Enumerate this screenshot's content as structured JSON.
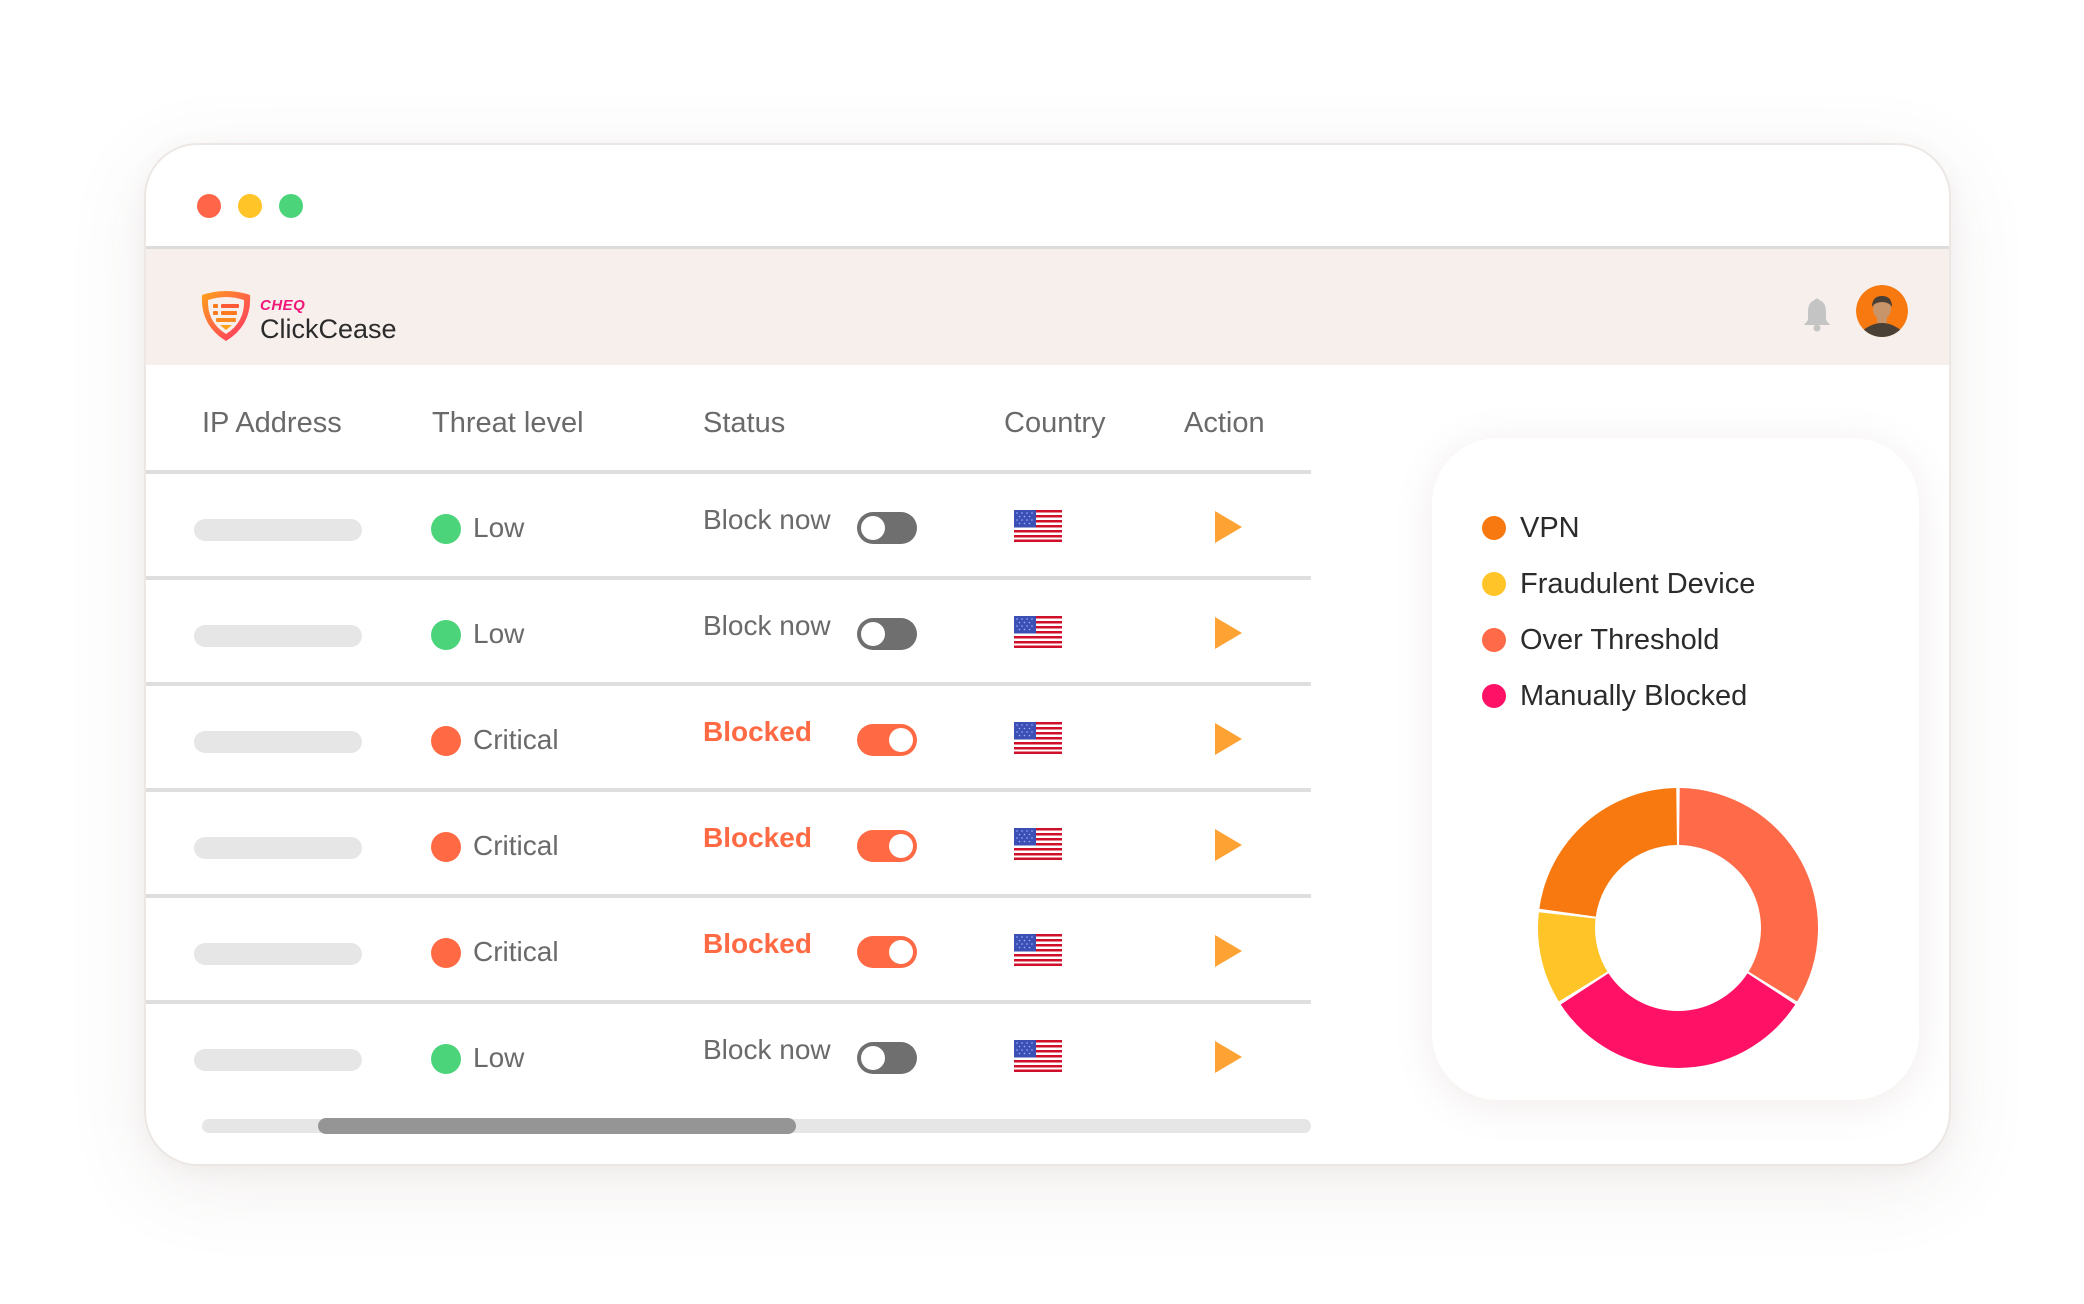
{
  "window": {
    "traffic_lights": [
      {
        "name": "close",
        "color": "#ff6548"
      },
      {
        "name": "minimize",
        "color": "#ffc427"
      },
      {
        "name": "maximize",
        "color": "#4cd47b"
      }
    ]
  },
  "header": {
    "brand_parent": "CHEQ",
    "brand_name": "ClickCease",
    "icons": [
      "notification-bell-icon",
      "user-avatar"
    ]
  },
  "table": {
    "columns": [
      "IP Address",
      "Threat level",
      "Status",
      "Country",
      "Action"
    ],
    "rows": [
      {
        "ip": "",
        "threat": "Low",
        "threat_color": "#4cd47b",
        "status": "Block now",
        "blocked": false,
        "country": "United States",
        "action": "play-icon"
      },
      {
        "ip": "",
        "threat": "Low",
        "threat_color": "#4cd47b",
        "status": "Block now",
        "blocked": false,
        "country": "United States",
        "action": "play-icon"
      },
      {
        "ip": "",
        "threat": "Critical",
        "threat_color": "#ff6a44",
        "status": "Blocked",
        "blocked": true,
        "country": "United States",
        "action": "play-icon"
      },
      {
        "ip": "",
        "threat": "Critical",
        "threat_color": "#ff6a44",
        "status": "Blocked",
        "blocked": true,
        "country": "United States",
        "action": "play-icon"
      },
      {
        "ip": "",
        "threat": "Critical",
        "threat_color": "#ff6a44",
        "status": "Blocked",
        "blocked": true,
        "country": "United States",
        "action": "play-icon"
      },
      {
        "ip": "",
        "threat": "Low",
        "threat_color": "#4cd47b",
        "status": "Block now",
        "blocked": false,
        "country": "United States",
        "action": "play-icon"
      }
    ],
    "scroll_position": 0.1
  },
  "colors": {
    "accent": "#ff6a44",
    "low": "#4cd47b",
    "action": "#ffa234",
    "header_bg": "#f7efec"
  },
  "chart_data": {
    "type": "pie",
    "variant": "donut",
    "title": "",
    "legend_position": "top-left",
    "categories": [
      "VPN",
      "Fraudulent Device",
      "Over Threshold",
      "Manually Blocked"
    ],
    "colors": [
      "#f7790f",
      "#ffc427",
      "#ff6a48",
      "#ff1166"
    ],
    "values": [
      23,
      11,
      34,
      32
    ],
    "draw_order": [
      "Over Threshold",
      "Manually Blocked",
      "Fraudulent Device",
      "VPN"
    ]
  }
}
